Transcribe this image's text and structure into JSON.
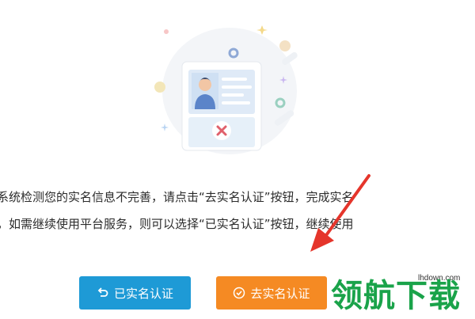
{
  "notice": {
    "line1": "系统检测您的实名信息不完善，请点击“去实名认证”按钮，完成实名",
    "line2": "，如需继续使用平台服务，则可以选择“已实名认证”按钮，继续使用"
  },
  "buttons": {
    "verified_label": "已实名认证",
    "verified_icon": "undo-icon",
    "go_verify_label": "去实名认证",
    "go_verify_icon": "check-circle-icon"
  },
  "watermark": {
    "text": "领航下载",
    "url": "lhdown.com"
  },
  "colors": {
    "primary_blue": "#1e9ad6",
    "accent_orange": "#f58a23",
    "arrow_red": "#e5352b",
    "watermark_green": "#1aa34a"
  }
}
